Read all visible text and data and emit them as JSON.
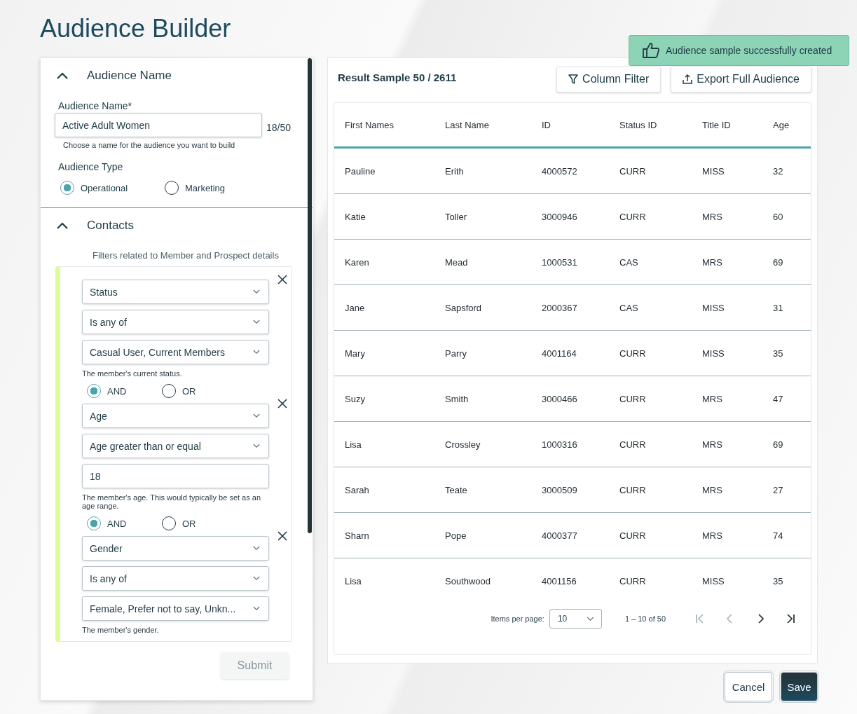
{
  "page_title": "Audience Builder",
  "toast": {
    "message": "Audience sample successfully created"
  },
  "audience_section": {
    "title": "Audience Name",
    "expanded": true,
    "name_label": "Audience Name*",
    "name_value": "Active Adult Women",
    "counter": "18/50",
    "hint": "Choose a name for the audience you want to build",
    "type_label": "Audience Type",
    "types": [
      {
        "label": "Operational",
        "selected": true
      },
      {
        "label": "Marketing",
        "selected": false
      }
    ]
  },
  "contacts_section": {
    "title": "Contacts",
    "expanded": true,
    "subtitle": "Filters related to Member and Prospect details",
    "filters": [
      {
        "fields": [
          {
            "kind": "select",
            "value": "Status"
          },
          {
            "kind": "select",
            "value": "Is any of"
          },
          {
            "kind": "select",
            "value": "Casual User, Current Members"
          }
        ],
        "hint": "The member's current status.",
        "connector": [
          {
            "label": "AND",
            "selected": true
          },
          {
            "label": "OR",
            "selected": false
          }
        ]
      },
      {
        "fields": [
          {
            "kind": "select",
            "value": "Age"
          },
          {
            "kind": "select",
            "value": "Age greater than or equal"
          },
          {
            "kind": "input",
            "value": "18"
          }
        ],
        "hint": "The member's age. This would typically be set as an age range.",
        "connector": [
          {
            "label": "AND",
            "selected": true
          },
          {
            "label": "OR",
            "selected": false
          }
        ]
      },
      {
        "fields": [
          {
            "kind": "select",
            "value": "Gender"
          },
          {
            "kind": "select",
            "value": "Is any of"
          },
          {
            "kind": "select",
            "value": "Female, Prefer not to say, Unkn..."
          }
        ],
        "hint": "The member's gender."
      }
    ],
    "submit": {
      "label": "Submit",
      "disabled": true
    }
  },
  "results": {
    "title": "Result Sample 50 / 2611",
    "buttons": [
      {
        "kind": "filter",
        "label": "Column Filter"
      },
      {
        "kind": "export",
        "label": "Export Full Audience"
      }
    ],
    "columns": [
      "First Names",
      "Last Name",
      "ID",
      "Status ID",
      "Title ID",
      "Age"
    ],
    "rows": [
      [
        "Pauline",
        "Erith",
        "4000572",
        "CURR",
        "MISS",
        "32"
      ],
      [
        "Katie",
        "Toller",
        "3000946",
        "CURR",
        "MRS",
        "60"
      ],
      [
        "Karen",
        "Mead",
        "1000531",
        "CAS",
        "MRS",
        "69"
      ],
      [
        "Jane",
        "Sapsford",
        "2000367",
        "CAS",
        "MISS",
        "31"
      ],
      [
        "Mary",
        "Parry",
        "4001164",
        "CURR",
        "MISS",
        "35"
      ],
      [
        "Suzy",
        "Smith",
        "3000466",
        "CURR",
        "MRS",
        "47"
      ],
      [
        "Lisa",
        "Crossley",
        "1000316",
        "CURR",
        "MRS",
        "69"
      ],
      [
        "Sarah",
        "Teate",
        "3000509",
        "CURR",
        "MRS",
        "27"
      ],
      [
        "Sharn",
        "Pope",
        "4000377",
        "CURR",
        "MRS",
        "74"
      ],
      [
        "Lisa",
        "Southwood",
        "4001156",
        "CURR",
        "MISS",
        "35"
      ]
    ],
    "pagination": {
      "items_label": "Items per page:",
      "page_size": "10",
      "range": "1 – 10 of 50",
      "buttons": [
        {
          "kind": "first",
          "disabled": true
        },
        {
          "kind": "prev",
          "disabled": true
        },
        {
          "kind": "next",
          "disabled": false
        },
        {
          "kind": "last",
          "disabled": false
        }
      ]
    }
  },
  "actions": [
    {
      "kind": "secondary",
      "label": "Cancel"
    },
    {
      "kind": "primary",
      "label": "Save"
    }
  ]
}
